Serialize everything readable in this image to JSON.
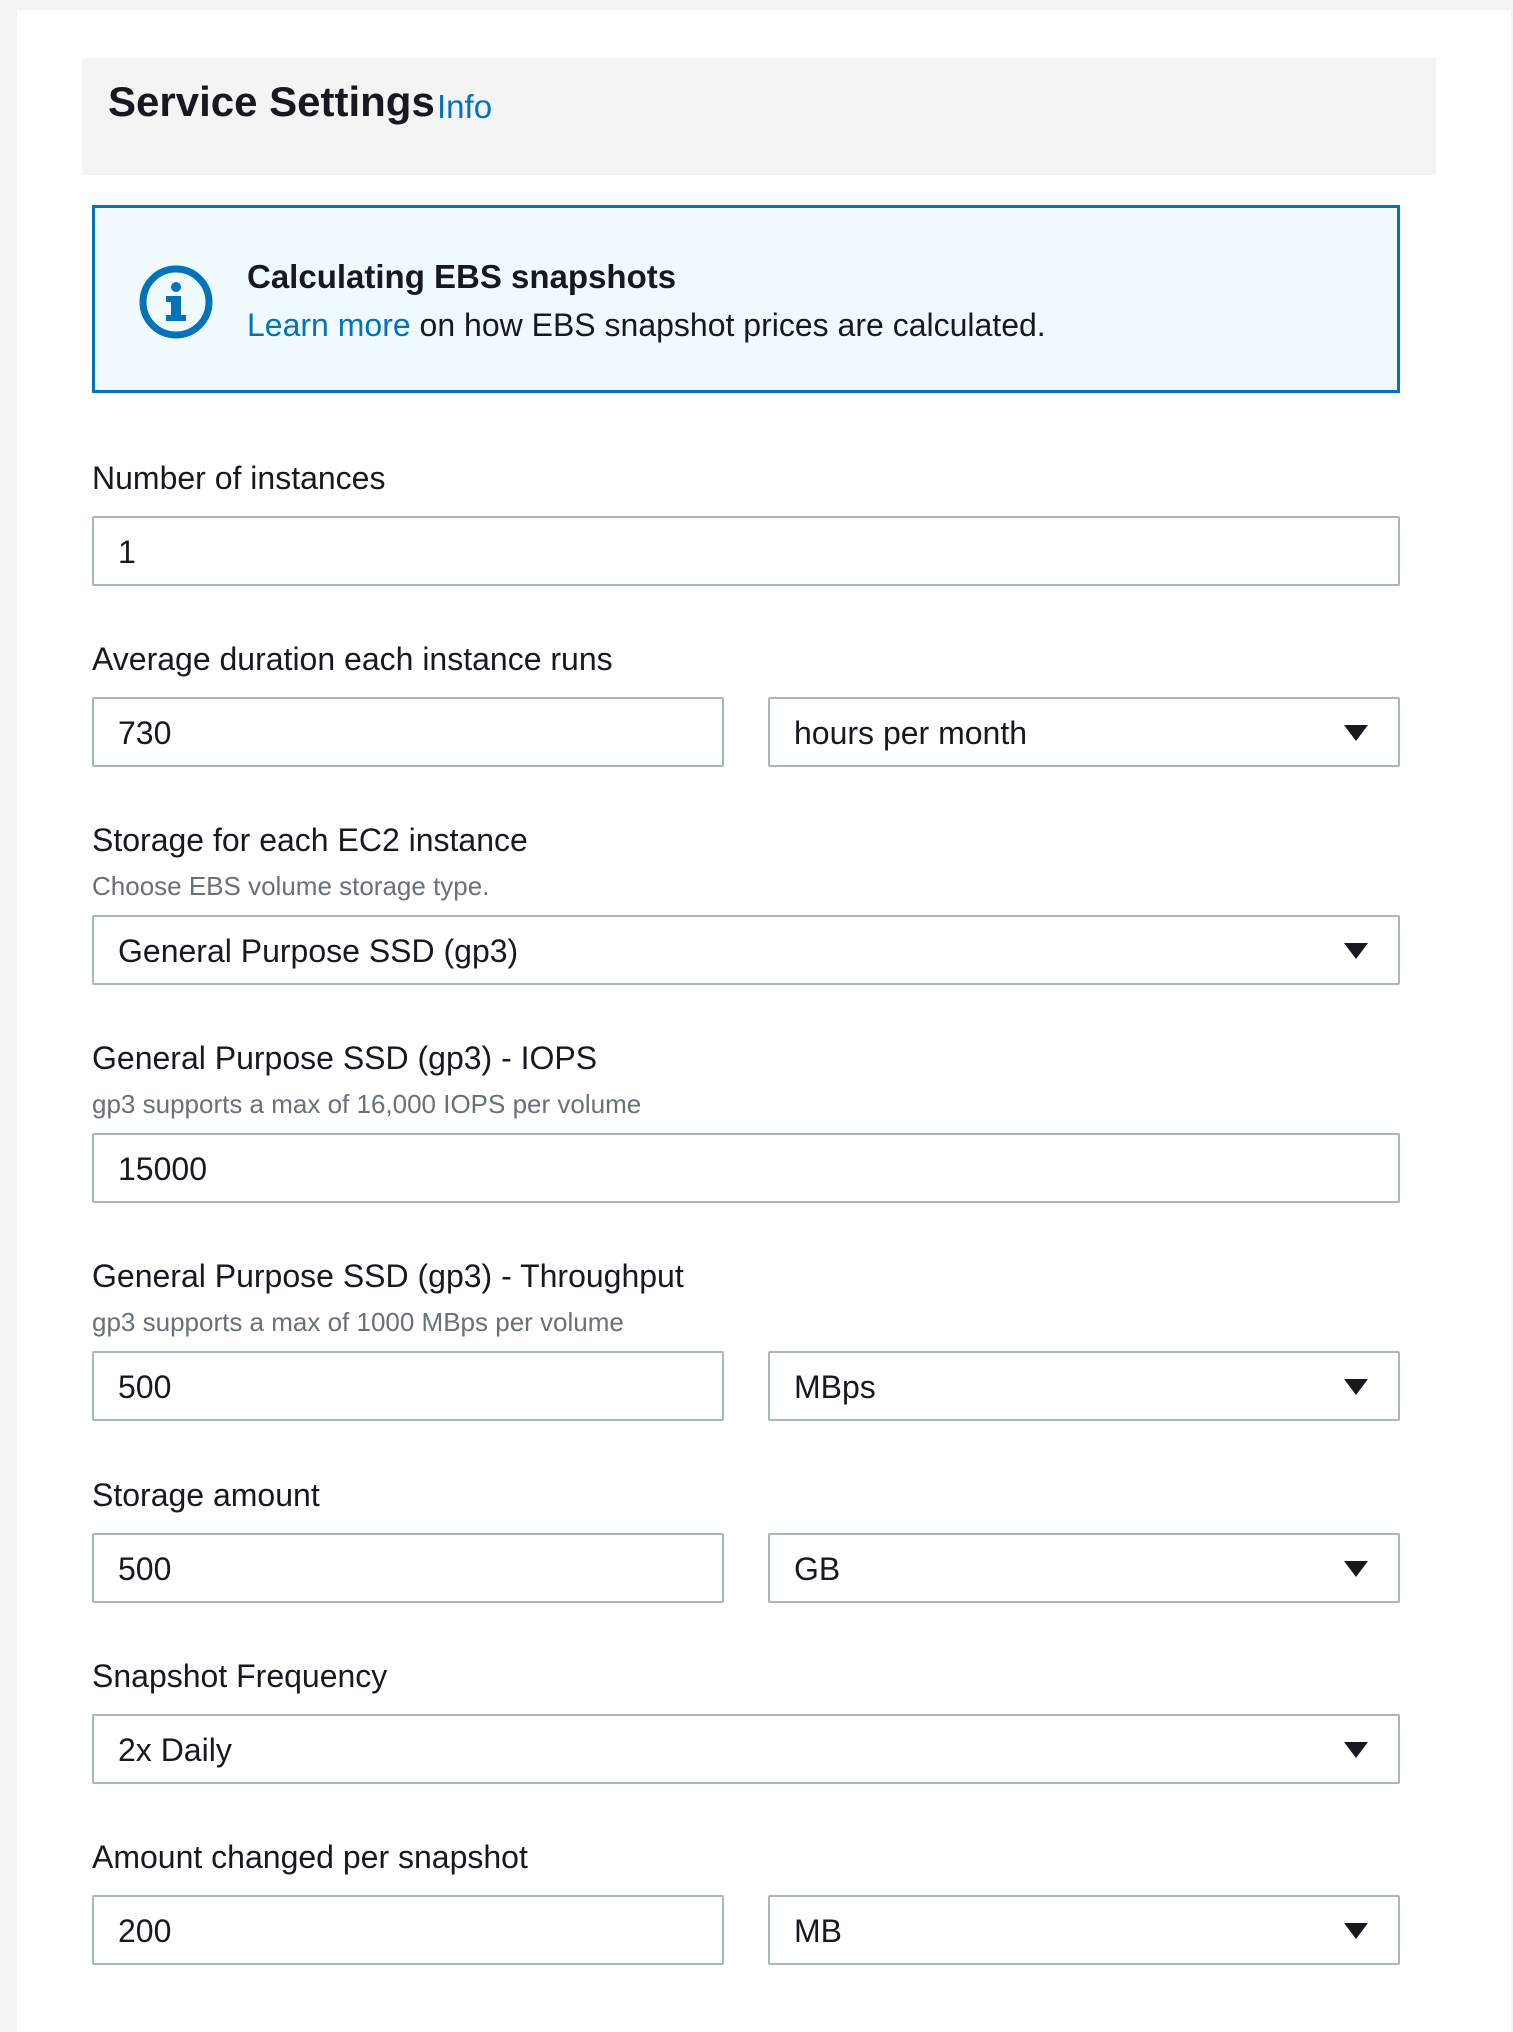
{
  "header": {
    "title": "Service Settings",
    "info_link": "Info"
  },
  "alert": {
    "icon": "info-icon",
    "title": "Calculating EBS snapshots",
    "link_text": "Learn more",
    "body_text": " on how EBS snapshot prices are calculated."
  },
  "fields": {
    "instances": {
      "label": "Number of instances",
      "value": "1"
    },
    "duration": {
      "label": "Average duration each instance runs",
      "value": "730",
      "unit": "hours per month"
    },
    "storage_type": {
      "label": "Storage for each EC2 instance",
      "description": "Choose EBS volume storage type.",
      "value": "General Purpose SSD (gp3)"
    },
    "iops": {
      "label": "General Purpose SSD (gp3) - IOPS",
      "description": "gp3 supports a max of 16,000 IOPS per volume",
      "value": "15000"
    },
    "throughput": {
      "label": "General Purpose SSD (gp3) - Throughput",
      "description": "gp3 supports a max of 1000 MBps per volume",
      "value": "500",
      "unit": "MBps"
    },
    "storage_amount": {
      "label": "Storage amount",
      "value": "500",
      "unit": "GB"
    },
    "snapshot_frequency": {
      "label": "Snapshot Frequency",
      "value": "2x Daily"
    },
    "amount_changed": {
      "label": "Amount changed per snapshot",
      "value": "200",
      "unit": "MB"
    }
  },
  "colors": {
    "link": "#0073bb",
    "alert_bg": "#f1faff",
    "border": "#aab7b8"
  }
}
